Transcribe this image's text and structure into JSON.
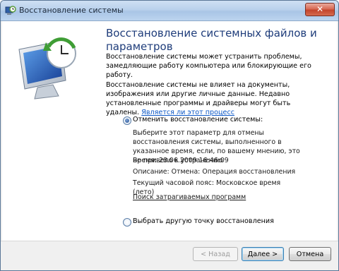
{
  "window": {
    "title": "Восстановление системы",
    "close_label": "✕"
  },
  "main": {
    "heading": "Восстановление системных файлов и параметров",
    "intro": "Восстановление системы может устранить проблемы, замедляющие работу компьютера или блокирующие его работу.",
    "info_text": "Восстановление системы не влияет на документы, изображения или другие личные данные. Недавно установленные программы и драйверы могут быть удалены.",
    "info_link": "Является ли этот процесс"
  },
  "option_undo": {
    "label": "Отменить восстановление системы:",
    "description": "Выберите этот параметр для отмены восстановления системы, выполненного в указанное время, если, по вашему мнению, это не привело к устранению",
    "time": "Время: 28.06.2009 16:46:09",
    "desc_line": "Описание: Отмена: Операция восстановления",
    "timezone": "Текущий часовой пояс: Московское время (лето)",
    "scan_link": "Поиск затрагиваемых программ",
    "selected": true
  },
  "option_other": {
    "label": "Выбрать другую точку восстановления",
    "selected": false
  },
  "buttons": {
    "back": "< Назад",
    "next": "Далее >",
    "cancel": "Отмена"
  }
}
